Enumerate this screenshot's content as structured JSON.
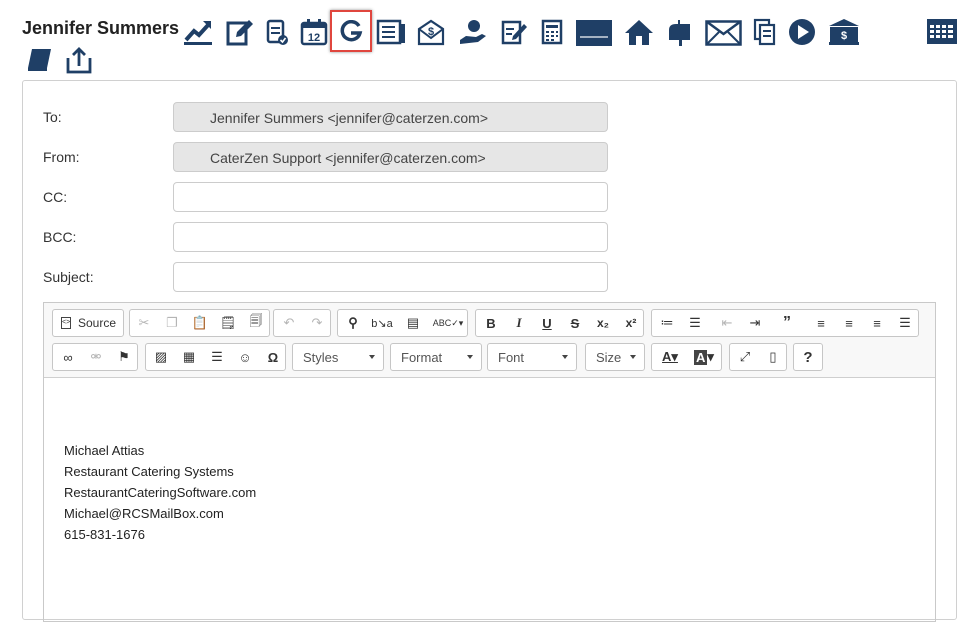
{
  "header": {
    "name": "Jennifer Summers",
    "icons": [
      "trend-up-icon",
      "edit-note-icon",
      "checklist-icon",
      "calendar-icon",
      "google-icon",
      "ledger-icon",
      "invoice-mail-icon",
      "payment-hand-icon",
      "signature-doc-icon",
      "spreadsheet-icon",
      "card-icon",
      "home-icon",
      "mailbox-icon",
      "envelope-icon",
      "documents-icon",
      "play-icon",
      "bank-icon",
      "grid-calendar-icon",
      "book-icon",
      "share-icon"
    ],
    "calendar_day": "12",
    "bank_text": "$"
  },
  "form": {
    "to_label": "To:",
    "to_value": "Jennifer Summers <jennifer@caterzen.com>",
    "from_label": "From:",
    "from_value": "CaterZen Support <jennifer@caterzen.com>",
    "cc_label": "CC:",
    "bcc_label": "BCC:",
    "subject_label": "Subject:"
  },
  "toolbar": {
    "source_label": "Source",
    "styles_label": "Styles",
    "format_label": "Format",
    "font_label": "Font",
    "size_label": "Size",
    "bold": "B",
    "italic": "I",
    "underline": "U",
    "strike": "S",
    "help": "?"
  },
  "body": {
    "signature": [
      "Michael Attias",
      "Restaurant Catering Systems",
      "RestaurantCateringSoftware.com",
      "Michael@RCSMailBox.com",
      "615-831-1676"
    ]
  }
}
